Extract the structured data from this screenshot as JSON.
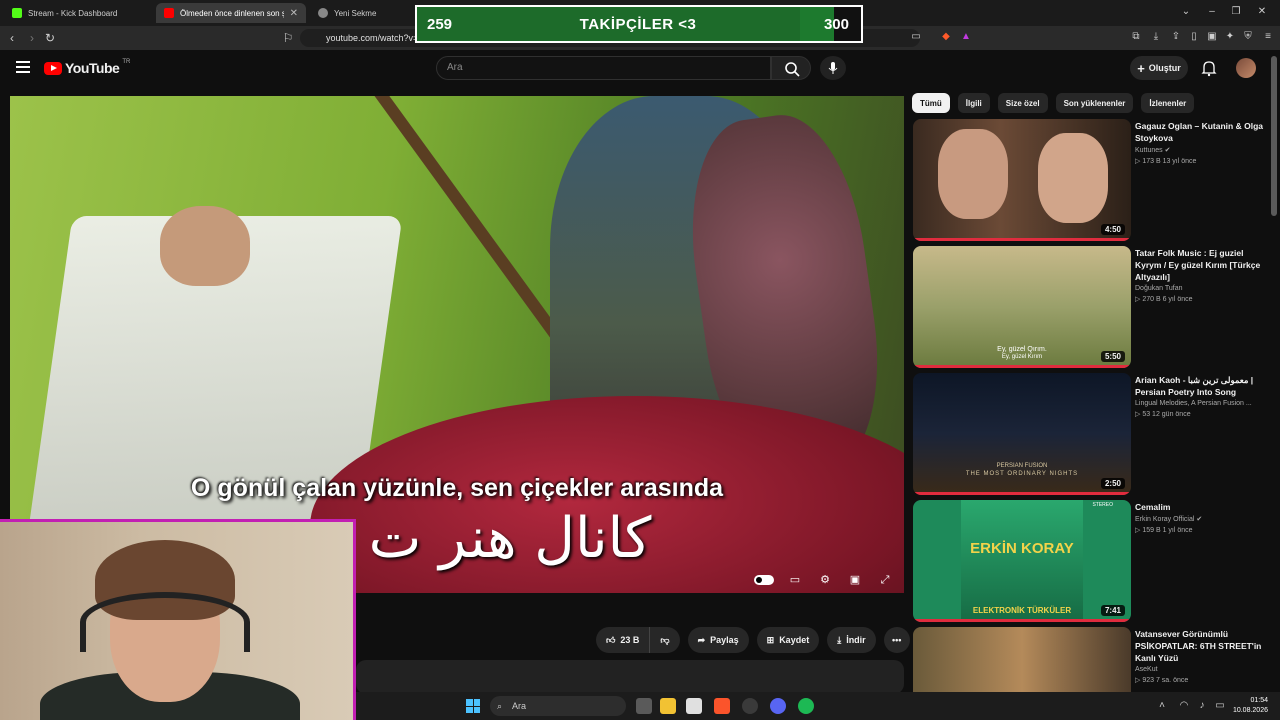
{
  "browser": {
    "tabs": [
      {
        "label": "Stream - Kick Dashboard",
        "active": false
      },
      {
        "label": "Ölmeden önce dinlenen son ş",
        "active": true
      },
      {
        "label": "Yeni Sekme",
        "active": false
      }
    ],
    "url": "youtube.com/watch?v="
  },
  "overlay": {
    "current": "259",
    "title": "TAKİPÇİLER <3",
    "goal": "300",
    "progress_fraction": 0.863
  },
  "header": {
    "logo_text": "YouTube",
    "region": "TR",
    "search_placeholder": "Ara",
    "create_label": "Oluştur"
  },
  "player": {
    "subtitle_turkish": "O gönül çalan yüzünle, sen çiçekler arasında",
    "subtitle_persian": "کانال هنر ت"
  },
  "actions": {
    "likes": "23 B",
    "share": "Paylaş",
    "save": "Kaydet",
    "download": "İndir"
  },
  "chips": [
    "Tümü",
    "İlgili",
    "Size özel",
    "Son yüklenenler",
    "İzlenenler"
  ],
  "recommendations": [
    {
      "title": "Gagauz Oglan – Kutanin & Olga Stoykova",
      "channel": "Kuttunes",
      "verified": true,
      "stats": "▷ 173 B   13 yıl önce",
      "duration": "4:50"
    },
    {
      "title": "Tatar Folk Music : Ej guziel Kyrym / Ey güzel Kırım [Türkçe Altyazılı]",
      "channel": "Doğukan Tufan",
      "verified": false,
      "stats": "▷ 270 B   6 yıl önce",
      "duration": "5:50",
      "thumb_caption": "Ey, güzel Qırım.",
      "thumb_caption2": "Ey, güzel Kırım"
    },
    {
      "title": "Arian Kaoh - معمولی ترین شبا | Persian Poetry Into Song",
      "channel": "Lingual Melodies, A Persian Fusion ...",
      "verified": false,
      "stats": "▷ 53   12 gün önce",
      "duration": "2:50",
      "thumb_caption": "PERSIAN FUSION",
      "thumb_caption2": "THE MOST ORDINARY NIGHTS"
    },
    {
      "title": "Cemalim",
      "channel": "Erkin Koray Official",
      "verified": true,
      "stats": "▷ 159 B   1 yıl önce",
      "duration": "7:41",
      "thumb_caption": "ERKİN KORAY",
      "thumb_caption2": "ELEKTRONİK TÜRKÜLER",
      "thumb_caption3": "STEREO"
    },
    {
      "title": "Vatansever Görünümlü PSİKOPATLAR: 6TH STREET'in Kanlı Yüzü",
      "channel": "AseKut",
      "verified": false,
      "stats": "▷ 923   7 sa. önce",
      "duration": ""
    }
  ],
  "taskbar": {
    "search_placeholder": "Ara",
    "time": "01:54",
    "date": "10.08.2026"
  },
  "colors": {
    "accent_red": "#ff0000",
    "overlay_green": "#1d7a2e",
    "webcam_border": "#c21fb3"
  }
}
